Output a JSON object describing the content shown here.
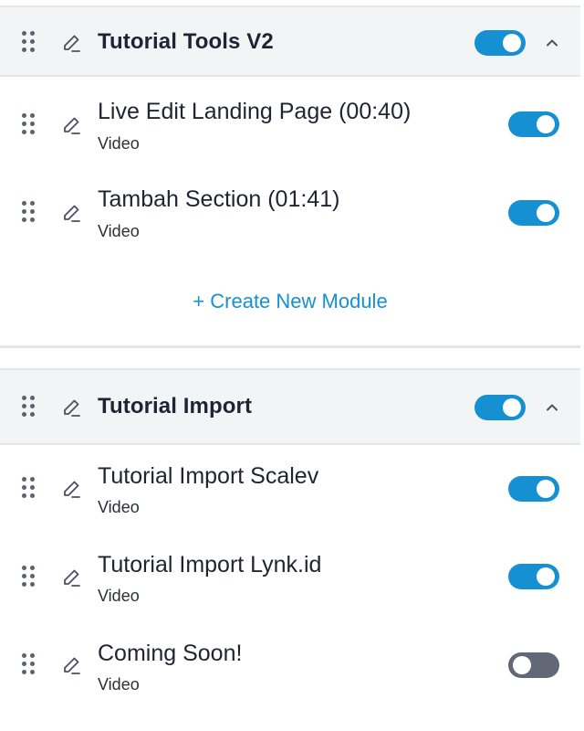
{
  "sections": [
    {
      "title": "Tutorial Tools V2",
      "enabled": true,
      "items": [
        {
          "title": "Live Edit Landing Page (00:40)",
          "type": "Video",
          "enabled": true
        },
        {
          "title": "Tambah Section (01:41)",
          "type": "Video",
          "enabled": true
        }
      ],
      "create_label": "+ Create New Module"
    },
    {
      "title": "Tutorial Import",
      "enabled": true,
      "items": [
        {
          "title": "Tutorial Import Scalev",
          "type": "Video",
          "enabled": true
        },
        {
          "title": "Tutorial Import Lynk.id",
          "type": "Video",
          "enabled": true
        },
        {
          "title": "Coming Soon!",
          "type": "Video",
          "enabled": false
        }
      ]
    }
  ],
  "icons": {
    "drag": "drag-handle-icon",
    "edit": "pencil-icon",
    "collapse": "chevron-up-icon"
  },
  "colors": {
    "accent": "#1591d3",
    "toggle_off": "#626876",
    "header_bg": "#f3f4f6"
  }
}
